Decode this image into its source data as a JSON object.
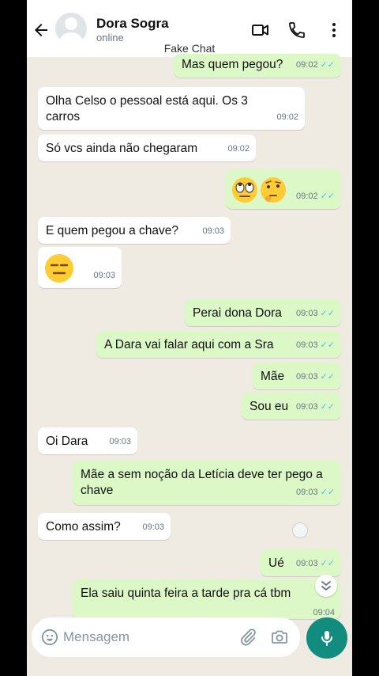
{
  "header": {
    "contact_name": "Dora Sogra",
    "status": "online",
    "watermark": "Fake Chat"
  },
  "messages": [
    {
      "dir": "out",
      "text": "Mas quem pegou?",
      "time": "09:02",
      "ticks": "✓✓"
    },
    {
      "dir": "in",
      "text": "Olha Celso o pessoal está aqui. Os 3 carros",
      "time": "09:02"
    },
    {
      "dir": "in",
      "text": "Só vcs ainda não chegaram",
      "time": "09:02"
    },
    {
      "dir": "out",
      "text": "🙄🤔",
      "time": "09:02",
      "ticks": "✓✓"
    },
    {
      "dir": "in",
      "text": "E quem pegou a chave?",
      "time": "09:03"
    },
    {
      "dir": "in",
      "text": "😑",
      "time": "09:03"
    },
    {
      "dir": "out",
      "text": "Perai dona Dora",
      "time": "09:03",
      "ticks": "✓✓"
    },
    {
      "dir": "out",
      "text": "A Dara vai falar aqui com a Sra",
      "time": "09:03",
      "ticks": "✓✓"
    },
    {
      "dir": "out",
      "text": "Mãe",
      "time": "09:03",
      "ticks": "✓✓"
    },
    {
      "dir": "out",
      "text": "Sou eu",
      "time": "09:03",
      "ticks": "✓✓"
    },
    {
      "dir": "in",
      "text": "Oi Dara",
      "time": "09:03"
    },
    {
      "dir": "out",
      "text": "Mãe a sem noção da Letícia deve ter pego a chave",
      "time": "09:03",
      "ticks": "✓✓"
    },
    {
      "dir": "in",
      "text": "Como assim?",
      "time": "09:03"
    },
    {
      "dir": "out",
      "text": "Ué",
      "time": "09:03",
      "ticks": "✓✓"
    },
    {
      "dir": "out",
      "text": "Ela saiu quinta feira a tarde pra cá tbm",
      "time": "09:04",
      "ticks": ""
    }
  ],
  "composer": {
    "placeholder": "Mensagem"
  },
  "colors": {
    "incoming": "#ffffff",
    "outgoing": "#dcf8c6",
    "accent": "#128c7e",
    "read_ticks": "#53bdeb"
  },
  "icons": [
    "back-arrow-icon",
    "video-call-icon",
    "phone-icon",
    "more-options-icon",
    "emoji-icon",
    "attach-icon",
    "camera-icon",
    "mic-icon",
    "scroll-down-icon"
  ]
}
